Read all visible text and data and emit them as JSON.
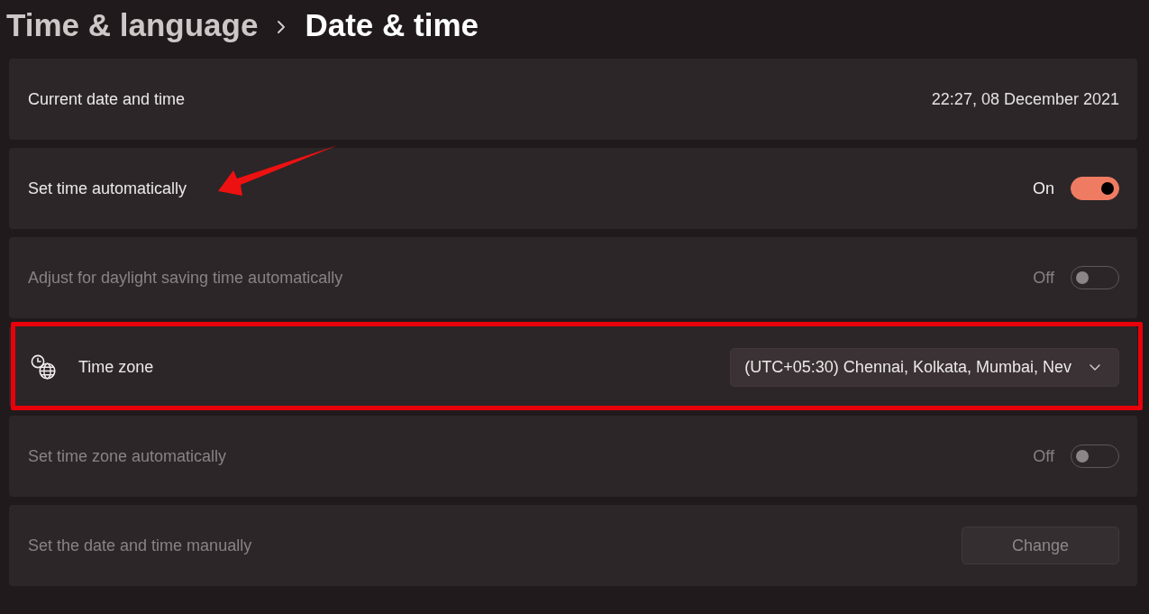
{
  "breadcrumb": [
    {
      "label": "Time & language",
      "current": false
    },
    {
      "label": "Date & time",
      "current": true
    }
  ],
  "rows": [
    {
      "kind": "value",
      "label": "Current date and time",
      "value": "22:27, 08 December 2021",
      "disabled": false,
      "highlighted": false,
      "arrow": false
    },
    {
      "kind": "toggle",
      "label": "Set time automatically",
      "state_label": "On",
      "on": true,
      "disabled": false,
      "highlighted": false,
      "arrow": true
    },
    {
      "kind": "toggle",
      "label": "Adjust for daylight saving time automatically",
      "state_label": "Off",
      "on": false,
      "disabled": true,
      "highlighted": false,
      "arrow": false
    },
    {
      "kind": "dropdown",
      "label": "Time zone",
      "value": "(UTC+05:30) Chennai, Kolkata, Mumbai, Nev",
      "disabled": false,
      "highlighted": true,
      "arrow": false
    },
    {
      "kind": "toggle",
      "label": "Set time zone automatically",
      "state_label": "Off",
      "on": false,
      "disabled": true,
      "highlighted": false,
      "arrow": false
    },
    {
      "kind": "button",
      "label": "Set the date and time manually",
      "button": "Change",
      "disabled": true,
      "highlighted": false,
      "arrow": false
    }
  ]
}
